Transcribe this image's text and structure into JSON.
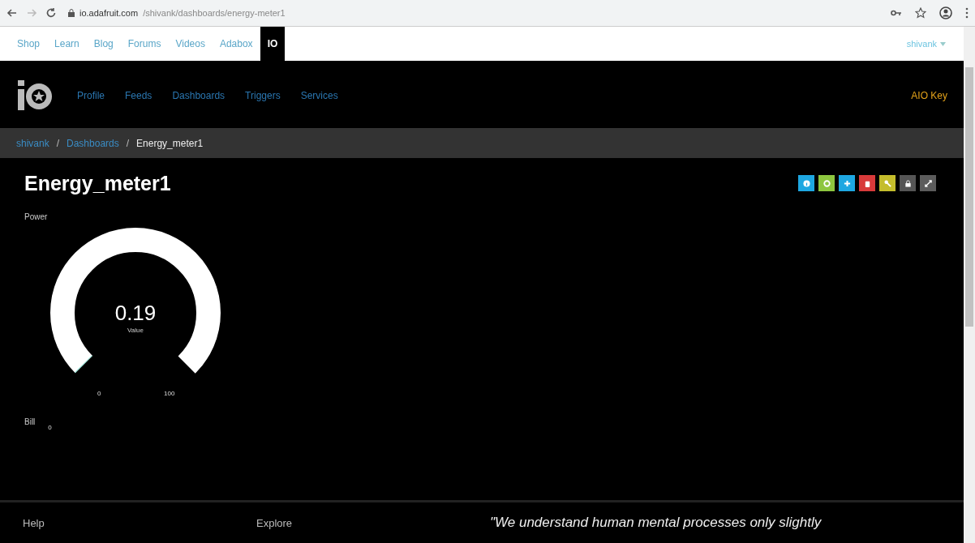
{
  "browser": {
    "url_host": "io.adafruit.com",
    "url_path": "/shivank/dashboards/energy-meter1"
  },
  "site_nav": {
    "links": [
      {
        "label": "Shop",
        "selected": false
      },
      {
        "label": "Learn",
        "selected": false
      },
      {
        "label": "Blog",
        "selected": false
      },
      {
        "label": "Forums",
        "selected": false
      },
      {
        "label": "Videos",
        "selected": false
      },
      {
        "label": "Adabox",
        "selected": false
      },
      {
        "label": "IO",
        "selected": true
      }
    ],
    "user": "shivank"
  },
  "io_nav": {
    "links": [
      "Profile",
      "Feeds",
      "Dashboards",
      "Triggers",
      "Services"
    ],
    "aio_key": "AIO Key"
  },
  "breadcrumb": [
    {
      "kind": "link",
      "text": "shivank"
    },
    {
      "kind": "separator",
      "text": "/"
    },
    {
      "kind": "link",
      "text": "Dashboards"
    },
    {
      "kind": "separator",
      "text": "/"
    },
    {
      "kind": "current",
      "text": "Energy_meter1"
    }
  ],
  "dashboard": {
    "title": "Energy_meter1",
    "tools": [
      {
        "kind": "info",
        "color": "#1ea7e1"
      },
      {
        "kind": "settings",
        "color": "#8dc63f"
      },
      {
        "kind": "add",
        "color": "#1ea7e1"
      },
      {
        "kind": "delete",
        "color": "#d83a3a"
      },
      {
        "kind": "key",
        "color": "#c4bd2c"
      },
      {
        "kind": "lock",
        "color": "#555555"
      },
      {
        "kind": "expand",
        "color": "#5c5c5c"
      }
    ],
    "gauge": {
      "title": "Power",
      "value": "0.19",
      "caption": "Value",
      "min": "0",
      "max": "100",
      "level": 0.0019
    },
    "text_block": {
      "title": "Bill",
      "value": "0"
    }
  },
  "footer": {
    "columns": [
      "Help",
      "Explore"
    ],
    "quote": "\"We understand human mental processes only slightly"
  }
}
